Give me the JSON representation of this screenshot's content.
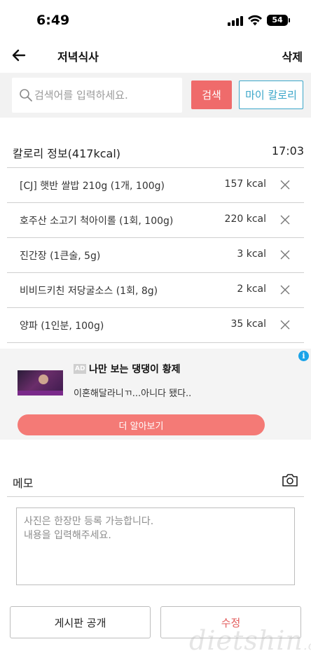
{
  "status_bar": {
    "time": "6:49",
    "battery": "54"
  },
  "header": {
    "title": "저녁식사",
    "delete_label": "삭제"
  },
  "search": {
    "placeholder": "검색어를 입력하세요.",
    "value": "",
    "search_label": "검색",
    "my_calorie_label": "마이 칼로리"
  },
  "calorie_info": {
    "title": "칼로리 정보(417kcal)",
    "time": "17:03",
    "items": [
      {
        "name": "[CJ] 햇반 쌀밥 210g (1개, 100g)",
        "kcal": "157 kcal"
      },
      {
        "name": "호주산 소고기 척아이롤 (1회, 100g)",
        "kcal": "220 kcal"
      },
      {
        "name": "진간장 (1큰술, 5g)",
        "kcal": "3 kcal"
      },
      {
        "name": "비비드키친 저당굴소스 (1회, 8g)",
        "kcal": "2 kcal"
      },
      {
        "name": "양파 (1인분, 100g)",
        "kcal": "35 kcal"
      }
    ]
  },
  "ad": {
    "badge": "AD",
    "title": "나만 보는 댕댕이 황제",
    "description": "이혼해달라니ㄲ...아니다 됐다..",
    "cta_label": "더 알아보기",
    "info_icon": "i"
  },
  "memo": {
    "title": "메모",
    "placeholder": "사진은 한장만 등록 가능합니다.\n내용을 입력해주세요.",
    "value": ""
  },
  "actions": {
    "board_label": "게시판 공개",
    "edit_label": "수정"
  },
  "watermark": {
    "main": "dietshin",
    "suffix": ".com"
  },
  "colors": {
    "search_button": "#ef6b6b",
    "my_calorie": "#3aa6c9",
    "cta": "#f47a76",
    "edit_text": "#e25a5a"
  }
}
